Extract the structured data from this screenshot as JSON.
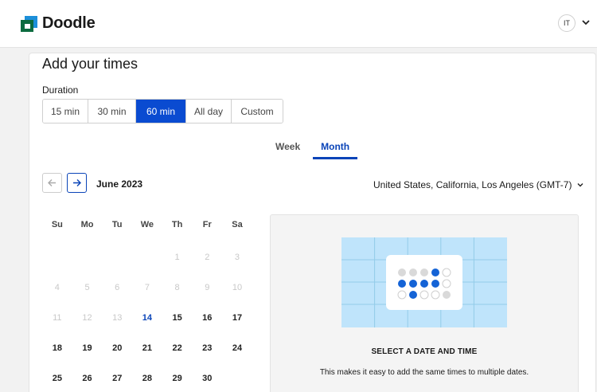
{
  "header": {
    "brand": "Doodle",
    "avatar_initials": "IT",
    "colors": {
      "brand_dark": "#0c6b3f",
      "brand_light": "#1c8fd9"
    }
  },
  "page": {
    "title": "Add your times",
    "duration_label": "Duration",
    "duration_options": [
      "15 min",
      "30 min",
      "60 min",
      "All day",
      "Custom"
    ],
    "duration_selected": "60 min",
    "view_tabs": [
      "Week",
      "Month"
    ],
    "view_selected": "Month",
    "month_label": "June 2023",
    "timezone": "United States, California, Los Angeles (GMT-7)",
    "accent": "#0a4bd1"
  },
  "calendar": {
    "weekdays": [
      "Su",
      "Mo",
      "Tu",
      "We",
      "Th",
      "Fr",
      "Sa"
    ],
    "weeks": [
      [
        "",
        "",
        "",
        "",
        "1",
        "2",
        "3"
      ],
      [
        "4",
        "5",
        "6",
        "7",
        "8",
        "9",
        "10"
      ],
      [
        "11",
        "12",
        "13",
        "14",
        "15",
        "16",
        "17"
      ],
      [
        "18",
        "19",
        "20",
        "21",
        "22",
        "23",
        "24"
      ],
      [
        "25",
        "26",
        "27",
        "28",
        "29",
        "30",
        ""
      ]
    ],
    "today": "14",
    "first_available": 14
  },
  "empty_state": {
    "title": "SELECT A DATE AND TIME",
    "description": "This makes it easy to add the same times to multiple dates."
  },
  "icons": {
    "prev": "arrow-left-icon",
    "next": "arrow-right-icon",
    "timezone_dropdown": "chevron-down-icon",
    "account_dropdown": "chevron-down-icon"
  }
}
